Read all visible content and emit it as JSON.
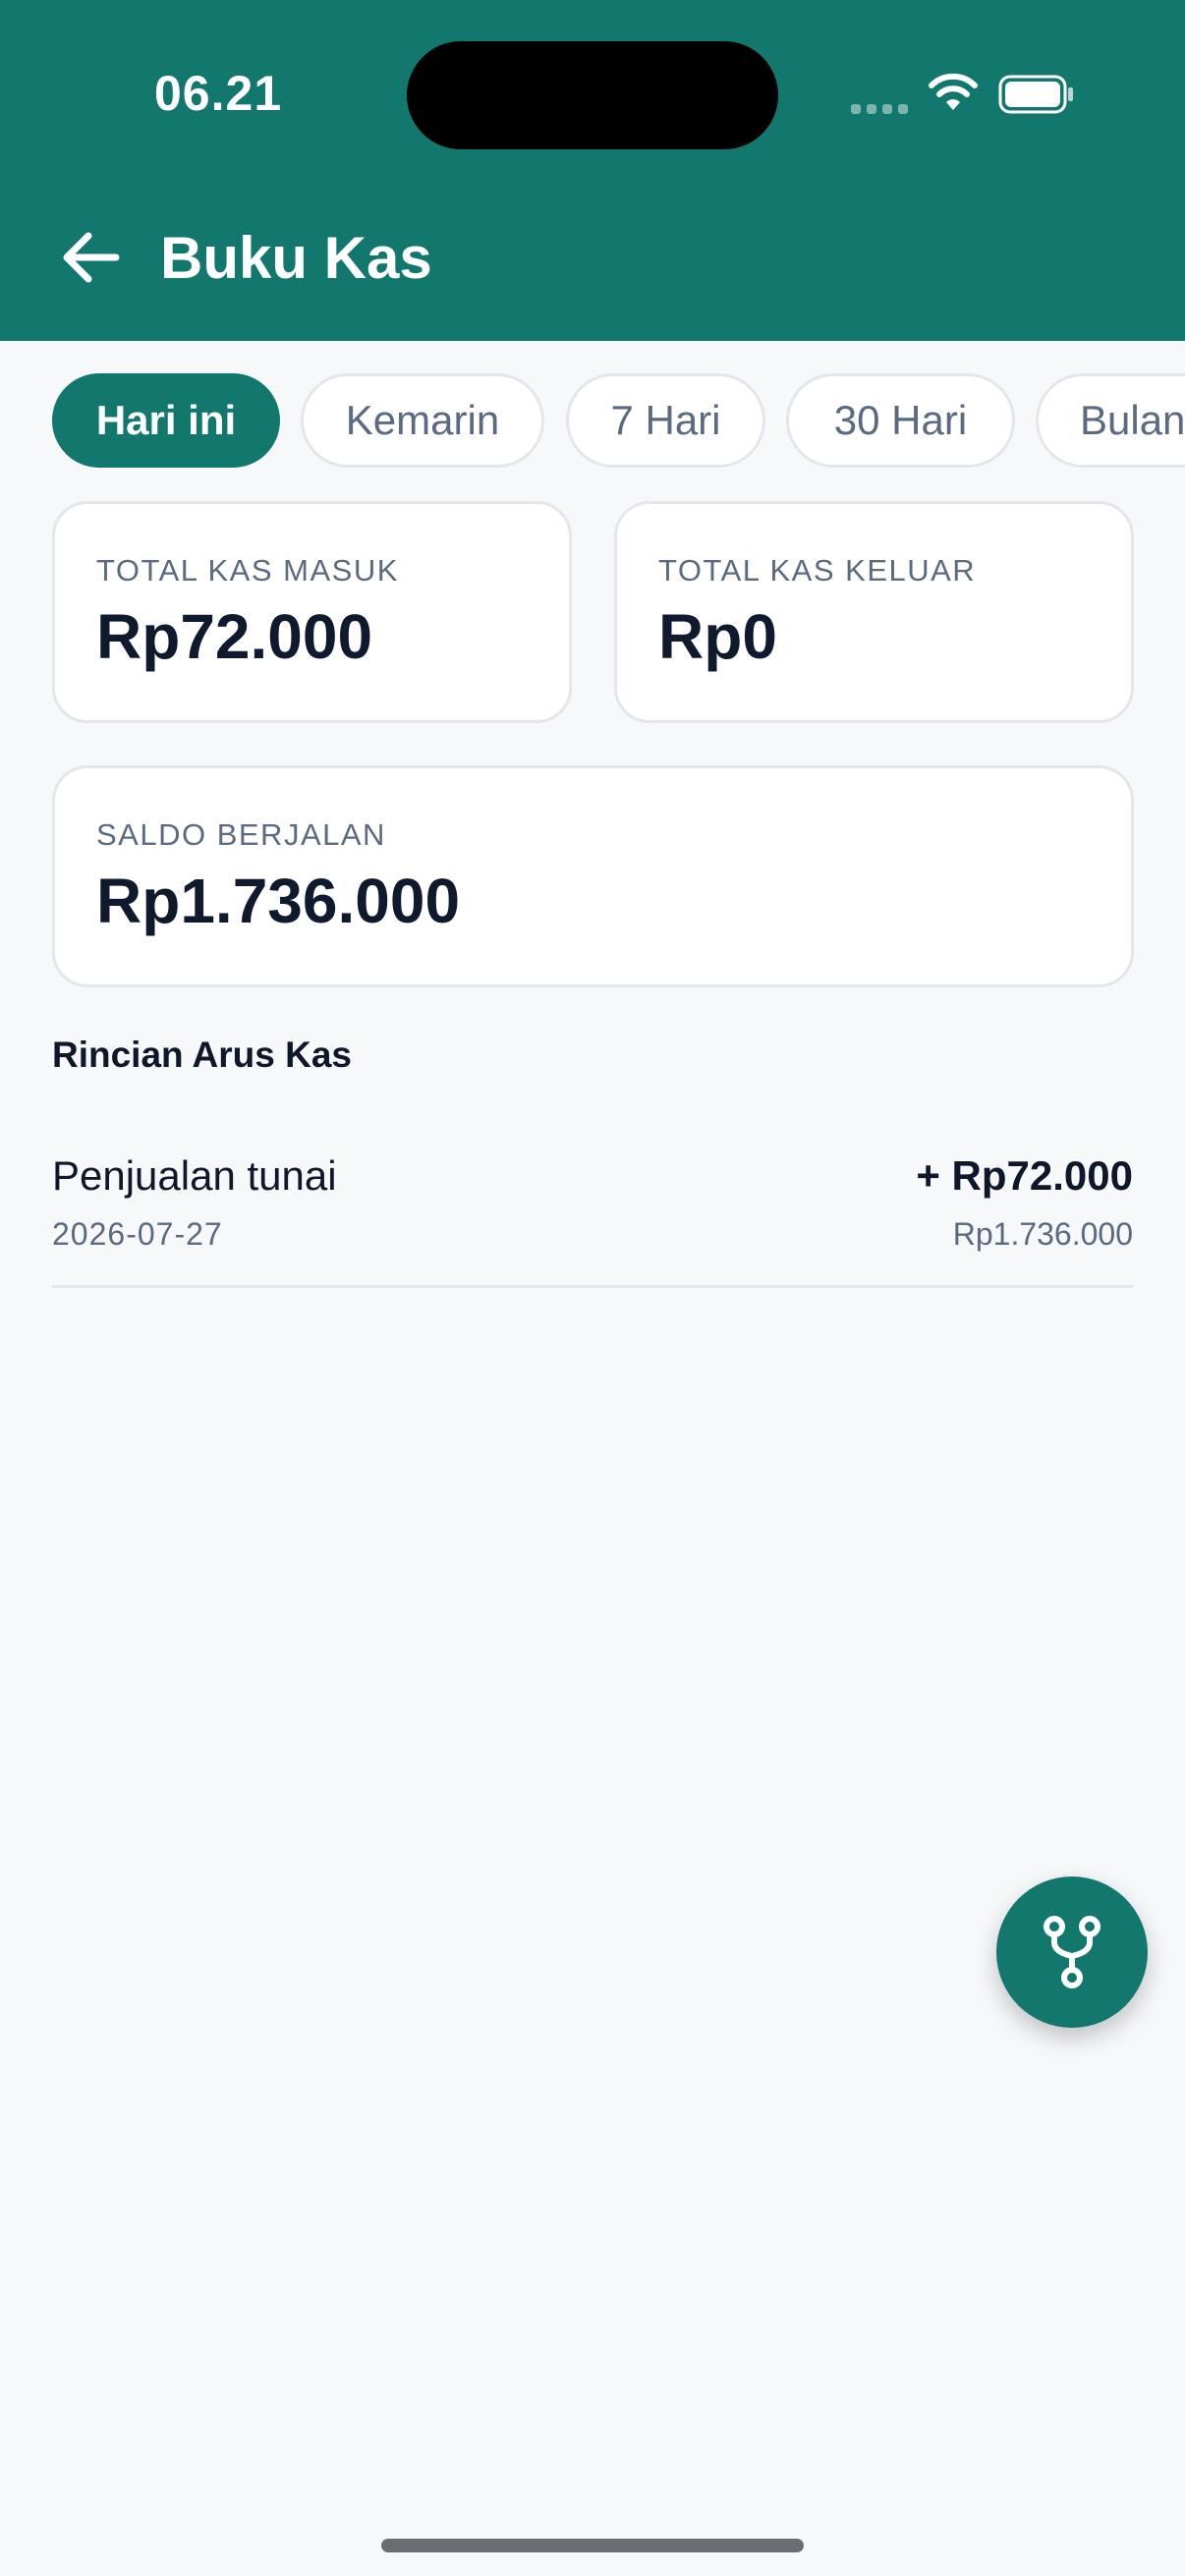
{
  "status_bar": {
    "time": "06.21",
    "icons": [
      "signal-icon",
      "wifi-icon",
      "battery-icon"
    ]
  },
  "header": {
    "title": "Buku Kas",
    "back_icon": "arrow-left-icon",
    "background": "#12776c"
  },
  "filters": {
    "items": [
      {
        "label": "Hari ini",
        "active": true
      },
      {
        "label": "Kemarin",
        "active": false
      },
      {
        "label": "7 Hari",
        "active": false
      },
      {
        "label": "30 Hari",
        "active": false
      },
      {
        "label": "Bulan",
        "active": false
      }
    ]
  },
  "summary": {
    "cash_in_label": "TOTAL KAS MASUK",
    "cash_in_value": "Rp72.000",
    "cash_out_label": "TOTAL KAS KELUAR",
    "cash_out_value": "Rp0",
    "balance_label": "SALDO BERJALAN",
    "balance_value": "Rp1.736.000"
  },
  "details": {
    "title": "Rincian Arus Kas",
    "rows": [
      {
        "title": "Penjualan tunai",
        "date": "2026-07-27",
        "amount": "+ Rp72.000",
        "balance": "Rp1.736.000"
      }
    ]
  },
  "fab": {
    "icon": "fork-icon"
  },
  "colors": {
    "primary": "#12776c",
    "background": "#f7f8fa",
    "muted_text": "#5b6a80"
  }
}
